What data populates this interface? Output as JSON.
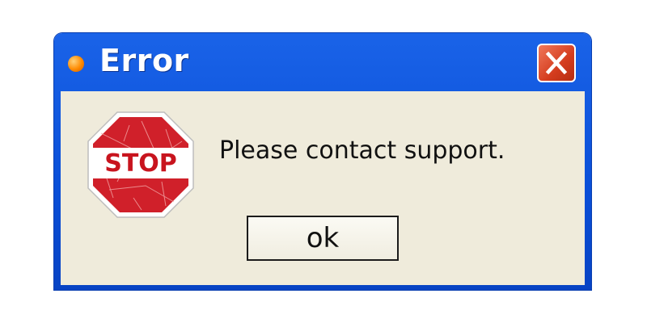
{
  "window": {
    "title": "Error",
    "app_icon": "orange-dot-icon",
    "close_icon": "close-x-icon"
  },
  "dialog": {
    "icon": "stop-sign-icon",
    "icon_text": "STOP",
    "message": "Please contact support.",
    "ok_label": "ok"
  },
  "colors": {
    "titlebar": "#0a4fd8",
    "client_background": "#efebdb",
    "close_button": "#d43c1e",
    "stop_sign": "#d0202a"
  }
}
